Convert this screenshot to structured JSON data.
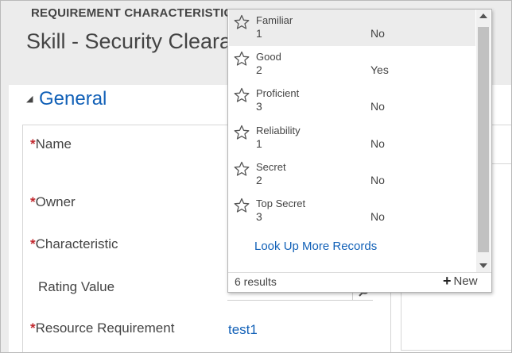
{
  "header": {
    "entity_type": "REQUIREMENT CHARACTERISTIC - INFORMATION",
    "record_title": "Skill - Security Clearance"
  },
  "section": {
    "title": "General",
    "toggle_glyph": "◢"
  },
  "fields": {
    "name_label": "Name",
    "owner_label": "Owner",
    "characteristic_label": "Characteristic",
    "rating_value_label": "Rating Value",
    "resource_requirement_label": "Resource Requirement",
    "resource_requirement_value": "test1",
    "required_marker": "*"
  },
  "lookup": {
    "results": [
      {
        "name": "Familiar",
        "value": "1",
        "flag": "No"
      },
      {
        "name": "Good",
        "value": "2",
        "flag": "Yes"
      },
      {
        "name": "Proficient",
        "value": "3",
        "flag": "No"
      },
      {
        "name": "Reliability",
        "value": "1",
        "flag": "No"
      },
      {
        "name": "Secret",
        "value": "2",
        "flag": "No"
      },
      {
        "name": "Top Secret",
        "value": "3",
        "flag": "No"
      }
    ],
    "look_up_more": "Look Up More Records",
    "results_count": "6 results",
    "new_label": "New",
    "icon": "star-outline-icon"
  },
  "colors": {
    "link": "#1160b7",
    "required": "#c1272d",
    "highlight": "#ececec"
  }
}
